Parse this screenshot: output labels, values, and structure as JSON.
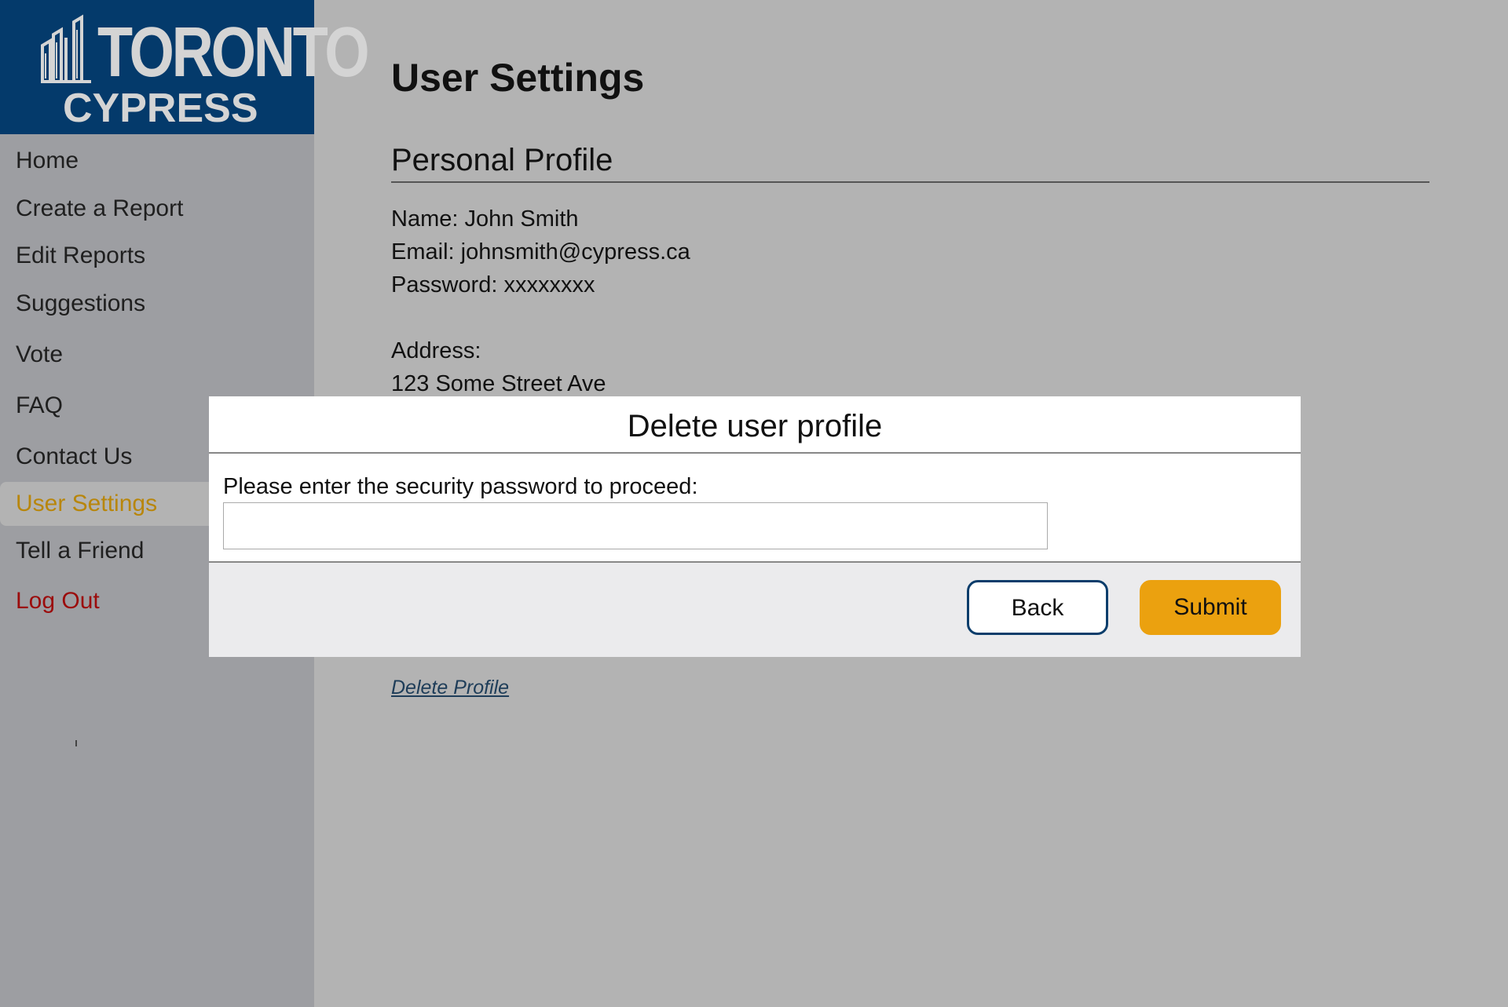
{
  "logo": {
    "line1": "TORONTO",
    "line2": "CYPRESS",
    "brand_color": "#043a6b"
  },
  "sidebar": {
    "items": [
      {
        "label": "Home",
        "state": "normal"
      },
      {
        "label": "Create a Report",
        "state": "normal"
      },
      {
        "label": "Edit Reports",
        "state": "normal"
      },
      {
        "label": "Suggestions",
        "state": "normal"
      },
      {
        "label": "Vote",
        "state": "normal"
      },
      {
        "label": "FAQ",
        "state": "normal"
      },
      {
        "label": "Contact Us",
        "state": "normal"
      },
      {
        "label": "User Settings",
        "state": "active"
      },
      {
        "label": "Tell a Friend",
        "state": "normal"
      },
      {
        "label": "Log Out",
        "state": "logout"
      }
    ],
    "active_color": "#b8860b",
    "logout_color": "#9b0b0b"
  },
  "main": {
    "page_title": "User Settings",
    "section_title": "Personal Profile",
    "name_line": "Name: John Smith",
    "email_line": "Email: johnsmith@cypress.ca",
    "password_line": "Password: xxxxxxxx",
    "address_label": "Address:",
    "address_line1": "123 Some Street Ave",
    "delete_link": "Delete Profile"
  },
  "modal": {
    "title": "Delete user profile",
    "prompt": "Please enter the security password to proceed:",
    "input_value": "",
    "back_label": "Back",
    "submit_label": "Submit",
    "submit_color": "#eba10f"
  }
}
